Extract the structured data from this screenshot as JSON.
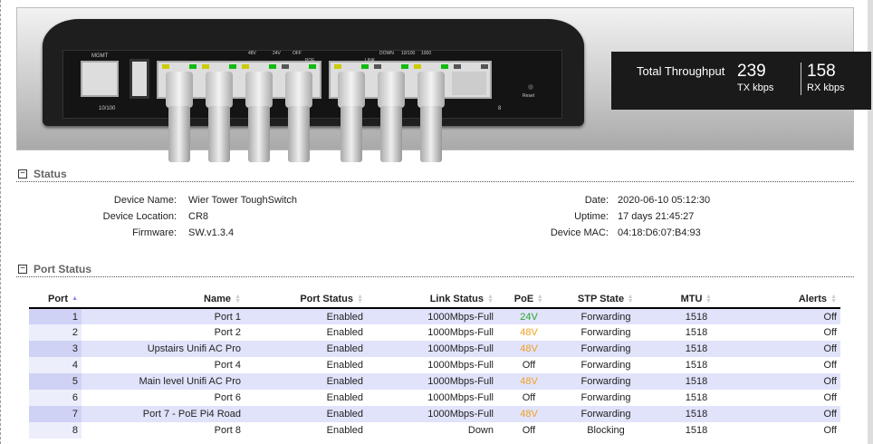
{
  "device_image": {
    "labels": {
      "mgmt": "MGMT",
      "mgmt_speed": "10/100",
      "reset": "Reset",
      "port8": "8",
      "legend_48v": "48V",
      "legend_24v": "24V",
      "legend_off": "OFF",
      "legend_poe": "POE",
      "legend_link": "LINK",
      "legend_down": "DOWN",
      "legend_10100": "10/100",
      "legend_1000": "1000"
    }
  },
  "throughput": {
    "title": "Total Throughput",
    "tx_value": "239",
    "tx_unit": "TX kbps",
    "rx_value": "158",
    "rx_unit": "RX kbps"
  },
  "status": {
    "title": "Status",
    "toggle": "−",
    "left": [
      {
        "k": "Device Name:",
        "v": "Wier Tower ToughSwitch"
      },
      {
        "k": "Device Location:",
        "v": "CR8"
      },
      {
        "k": "Firmware:",
        "v": "SW.v1.3.4"
      }
    ],
    "right": [
      {
        "k": "Date:",
        "v": "2020-06-10 05:12:30"
      },
      {
        "k": "Uptime:",
        "v": "17 days 21:45:27"
      },
      {
        "k": "Device MAC:",
        "v": "04:18:D6:07:B4:93"
      }
    ]
  },
  "port_status": {
    "title": "Port Status",
    "toggle": "−",
    "columns": [
      "Port",
      "Name",
      "Port Status",
      "Link Status",
      "PoE",
      "STP State",
      "MTU",
      "Alerts"
    ],
    "poe_colors": {
      "24V": "#2aa52a",
      "48V": "#f0a020",
      "Off": "#222"
    },
    "rows": [
      [
        "1",
        "Port 1",
        "Enabled",
        "1000Mbps-Full",
        "24V",
        "Forwarding",
        "1518",
        "Off"
      ],
      [
        "2",
        "Port 2",
        "Enabled",
        "1000Mbps-Full",
        "48V",
        "Forwarding",
        "1518",
        "Off"
      ],
      [
        "3",
        "Upstairs Unifi AC Pro",
        "Enabled",
        "1000Mbps-Full",
        "48V",
        "Forwarding",
        "1518",
        "Off"
      ],
      [
        "4",
        "Port 4",
        "Enabled",
        "1000Mbps-Full",
        "Off",
        "Forwarding",
        "1518",
        "Off"
      ],
      [
        "5",
        "Main level Unifi AC Pro",
        "Enabled",
        "1000Mbps-Full",
        "48V",
        "Forwarding",
        "1518",
        "Off"
      ],
      [
        "6",
        "Port 6",
        "Enabled",
        "1000Mbps-Full",
        "Off",
        "Forwarding",
        "1518",
        "Off"
      ],
      [
        "7",
        "Port 7 - PoE Pi4 Road",
        "Enabled",
        "1000Mbps-Full",
        "48V",
        "Forwarding",
        "1518",
        "Off"
      ],
      [
        "8",
        "Port 8",
        "Enabled",
        "Down",
        "Off",
        "Blocking",
        "1518",
        "Off"
      ]
    ]
  }
}
